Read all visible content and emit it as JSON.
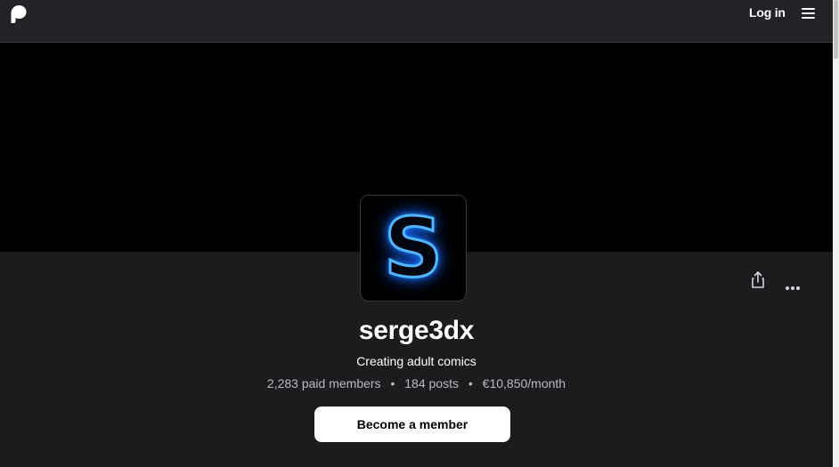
{
  "nav": {
    "logo_icon": "patreon-logo-icon",
    "login_label": "Log in",
    "menu_icon": "hamburger-menu-icon"
  },
  "creator": {
    "avatar_letter": "S",
    "name": "serge3dx",
    "tagline": "Creating adult comics",
    "stats": {
      "members": "2,283 paid members",
      "posts": "184 posts",
      "earnings": "€10,850/month",
      "separator": "•"
    }
  },
  "actions": {
    "share_icon": "share-icon",
    "more_icon": "more-options-icon"
  },
  "cta": {
    "label": "Become a member"
  },
  "colors": {
    "background": "#1c1b1e",
    "nav_background": "#242226",
    "banner": "#000000",
    "avatar_glow": "#4fb6ff",
    "button": "#ffffff"
  }
}
